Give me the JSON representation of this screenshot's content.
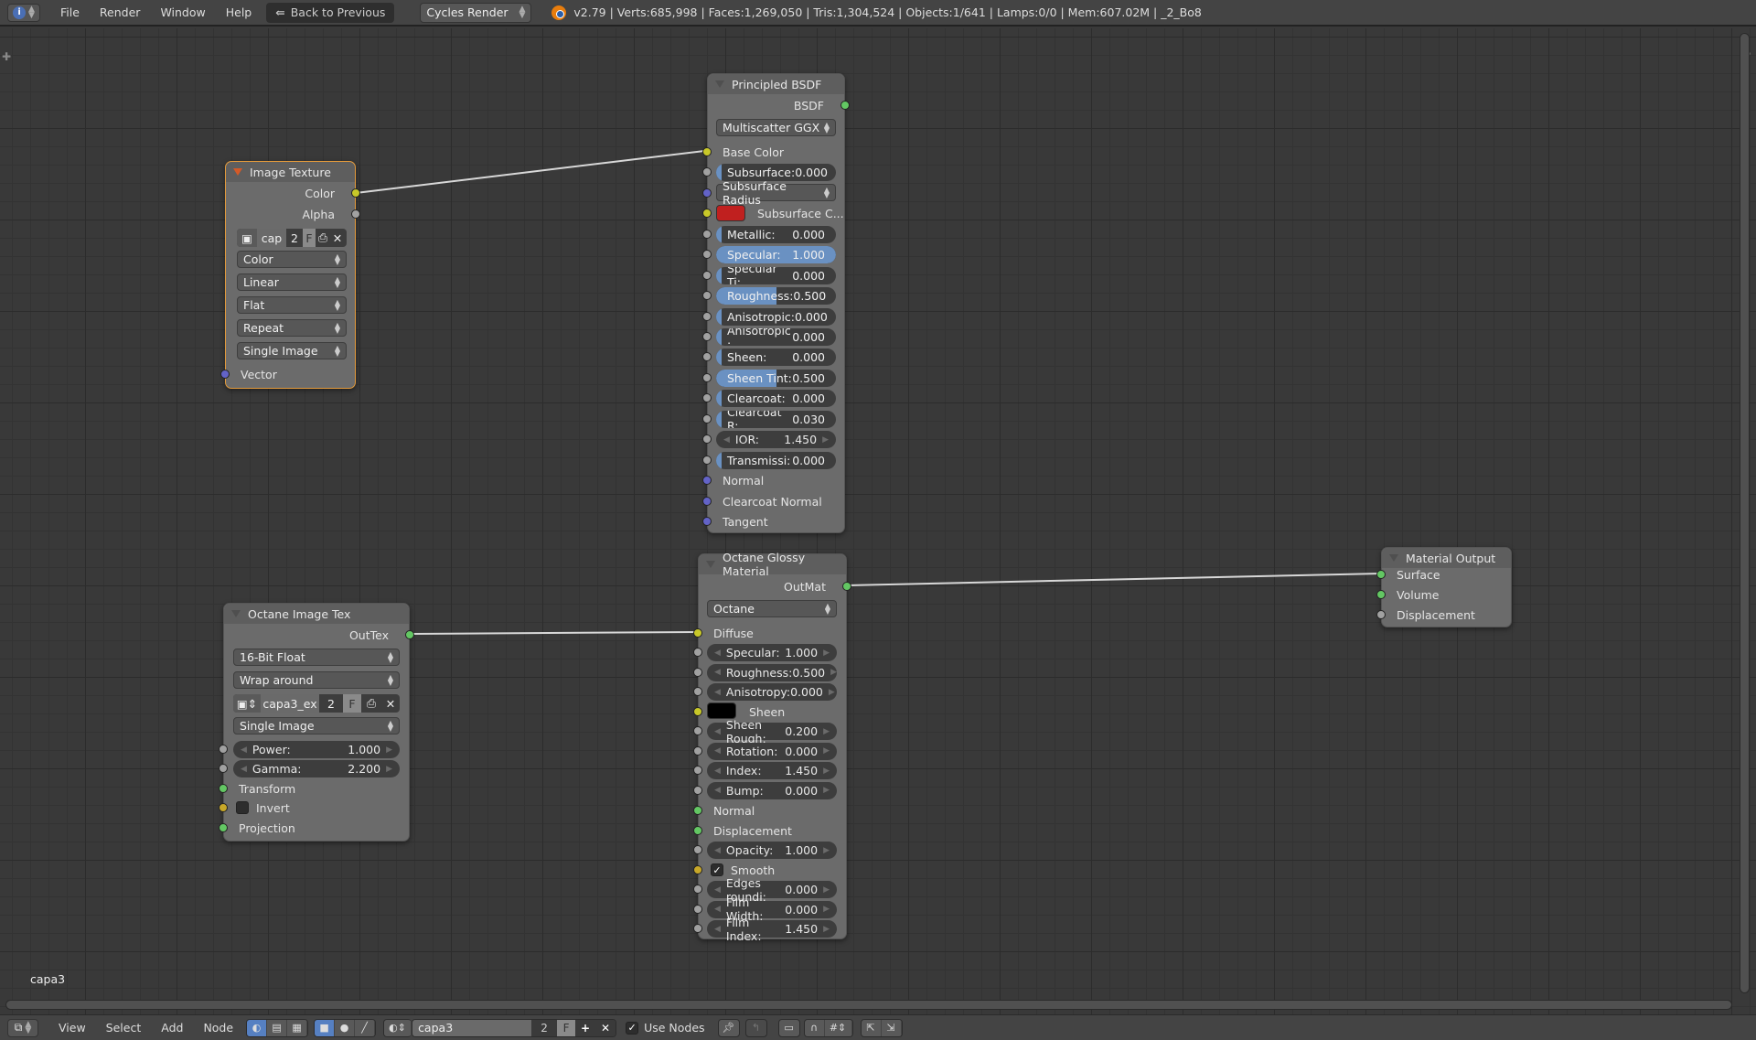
{
  "topbar": {
    "menus": [
      "File",
      "Render",
      "Window",
      "Help"
    ],
    "back_label": "Back to Previous",
    "render_engine": "Cycles Render",
    "stats": "v2.79 | Verts:685,998 | Faces:1,269,050 | Tris:1,304,524 | Objects:1/641 | Lamps:0/0 | Mem:607.02M | _2_Bo8"
  },
  "nodes": {
    "image_texture": {
      "title": "Image Texture",
      "outputs": [
        "Color",
        "Alpha"
      ],
      "image_name": "cap",
      "users": "2",
      "fake": "F",
      "color_space": "Color",
      "interpolation": "Linear",
      "projection": "Flat",
      "extension": "Repeat",
      "source": "Single Image",
      "inputs": [
        "Vector"
      ]
    },
    "principled": {
      "title": "Principled BSDF",
      "output": "BSDF",
      "distribution": "Multiscatter GGX",
      "base_color": "Base Color",
      "subsurface_radius": "Subsurface Radius",
      "subsurface_color_label": "Subsurface C...",
      "subsurface_color": "#c0201f",
      "sliders": [
        {
          "label": "Subsurface:",
          "value": "0.000",
          "fill": 0.0
        },
        {
          "label": "Metallic:",
          "value": "0.000",
          "fill": 0.0
        },
        {
          "label": "Specular:",
          "value": "1.000",
          "fill": 1.0
        },
        {
          "label": "Specular Ti:",
          "value": "0.000",
          "fill": 0.0
        },
        {
          "label": "Roughness:",
          "value": "0.500",
          "fill": 0.5
        },
        {
          "label": "Anisotropic:",
          "value": "0.000",
          "fill": 0.0
        },
        {
          "label": "Anisotropic :",
          "value": "0.000",
          "fill": 0.0
        },
        {
          "label": "Sheen:",
          "value": "0.000",
          "fill": 0.0
        },
        {
          "label": "Sheen Tint:",
          "value": "0.500",
          "fill": 0.5
        },
        {
          "label": "Clearcoat:",
          "value": "0.000",
          "fill": 0.0
        },
        {
          "label": "Clearcoat R:",
          "value": "0.030",
          "fill": 0.03
        }
      ],
      "ior_label": "IOR:",
      "ior_value": "1.450",
      "transmission_label": "Transmissi:",
      "transmission_value": "0.000",
      "vector_inputs": [
        "Normal",
        "Clearcoat Normal",
        "Tangent"
      ]
    },
    "octane_image_tex": {
      "title": "Octane Image Tex",
      "output": "OutTex",
      "format": "16-Bit Float",
      "border_mode": "Wrap around",
      "image_name": "capa3_ex",
      "users": "2",
      "fake": "F",
      "source": "Single Image",
      "power_label": "Power:",
      "power_value": "1.000",
      "gamma_label": "Gamma:",
      "gamma_value": "2.200",
      "transform": "Transform",
      "invert": "Invert",
      "invert_checked": false,
      "projection": "Projection"
    },
    "octane_glossy": {
      "title": "Octane Glossy Material",
      "output": "OutMat",
      "brdf": "Octane",
      "diffuse": "Diffuse",
      "sheen_label": "Sheen",
      "sheen_color": "#000000",
      "fields_a": [
        {
          "label": "Specular:",
          "value": "1.000"
        },
        {
          "label": "Roughness:",
          "value": "0.500"
        },
        {
          "label": "Anisotropy:",
          "value": "0.000"
        }
      ],
      "fields_b": [
        {
          "label": "Sheen Rough:",
          "value": "0.200"
        },
        {
          "label": "Rotation:",
          "value": "0.000"
        },
        {
          "label": "Index:",
          "value": "1.450"
        },
        {
          "label": "Bump:",
          "value": "0.000"
        }
      ],
      "normal": "Normal",
      "displacement": "Displacement",
      "opacity_label": "Opacity:",
      "opacity_value": "1.000",
      "smooth": "Smooth",
      "smooth_checked": true,
      "fields_c": [
        {
          "label": "Edges roundi:",
          "value": "0.000"
        },
        {
          "label": "Film Width:",
          "value": "0.000"
        },
        {
          "label": "Film Index:",
          "value": "1.450"
        }
      ]
    },
    "material_output": {
      "title": "Material Output",
      "inputs": [
        "Surface",
        "Volume",
        "Displacement"
      ]
    }
  },
  "material_label": "capa3",
  "bottombar": {
    "menus": [
      "View",
      "Select",
      "Add",
      "Node"
    ],
    "material_name": "capa3",
    "users": "2",
    "fake": "F",
    "use_nodes_label": "Use Nodes",
    "use_nodes_checked": true
  }
}
